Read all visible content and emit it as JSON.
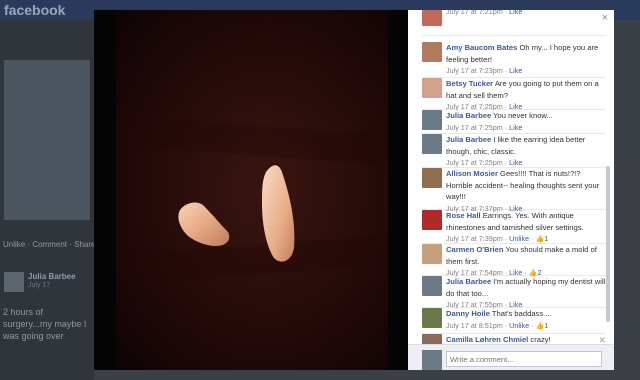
{
  "background_page": {
    "logo": "facebook",
    "actions": "Unlike · Comment · Share",
    "post_author": "Julia Barbee",
    "post_date": "July 17",
    "post_text": "2 hours of surgery...my maybe I was going over"
  },
  "viewer": {
    "close_icon": "×"
  },
  "comments": [
    {
      "name": "",
      "text": "",
      "time": "July 17 at 7:21pm",
      "like": "Like",
      "likes": "",
      "unlike": false,
      "avatar_color": "#c26a5a"
    },
    {
      "name": "Amy Baucom Bates",
      "text": "Oh my... I hope you are feeling better!",
      "time": "July 17 at 7:23pm",
      "like": "Like",
      "likes": "",
      "unlike": false,
      "avatar_color": "#b07b5e"
    },
    {
      "name": "Betsy Tucker",
      "text": "Are you going to put them on a hat and sell them?",
      "time": "July 17 at 7:25pm",
      "like": "Like",
      "likes": "",
      "unlike": false,
      "avatar_color": "#d2a28a"
    },
    {
      "name": "Julia Barbee",
      "text": "You never know...",
      "time": "July 17 at 7:25pm",
      "like": "Like",
      "likes": "",
      "unlike": false,
      "avatar_color": "#6a7a86"
    },
    {
      "name": "Julia Barbee",
      "text": "I like the earring idea better though, chic, classic.",
      "time": "July 17 at 7:25pm",
      "like": "Like",
      "likes": "",
      "unlike": false,
      "avatar_color": "#6a7a86"
    },
    {
      "name": "Allison Mosier",
      "text": "Gees!!!! That is nuts!?!? Horrible accident-- healing thoughts sent your way!!!",
      "time": "July 17 at 7:37pm",
      "like": "Like",
      "likes": "",
      "unlike": false,
      "avatar_color": "#8e6e4e"
    },
    {
      "name": "Rose Hall",
      "text": "Earrings. Yes. With antique rhinestones and tarnished silver settings.",
      "time": "July 17 at 7:39pm",
      "like": "Unlike",
      "likes": "1",
      "unlike": true,
      "avatar_color": "#b02a2a"
    },
    {
      "name": "Carmen O'Brien",
      "text": "You should make a mold of them first.",
      "time": "July 17 at 7:54pm",
      "like": "Like",
      "likes": "2",
      "unlike": false,
      "avatar_color": "#c9a07c"
    },
    {
      "name": "Julia Barbee",
      "text": "I'm actually hoping my dentist will do that too...",
      "time": "July 17 at 7:55pm",
      "like": "Like",
      "likes": "",
      "unlike": false,
      "avatar_color": "#6a7a86"
    },
    {
      "name": "Danny Hoile",
      "text": "That's baddass....",
      "time": "July 17 at 8:51pm",
      "like": "Unlike",
      "likes": "1",
      "unlike": true,
      "avatar_color": "#6a7a4a"
    },
    {
      "name": "Camilla Løhren Chmiel",
      "text": "crazy!",
      "time": "July 17 at 10:47pm",
      "like": "Like",
      "likes": "",
      "unlike": false,
      "avatar_color": "#8a6a5a"
    }
  ],
  "composer": {
    "placeholder": "Write a comment..."
  },
  "colors": {
    "link": "#3b5998",
    "panel_bg": "#ffffff",
    "photo_bg": "#2a0e0b"
  }
}
